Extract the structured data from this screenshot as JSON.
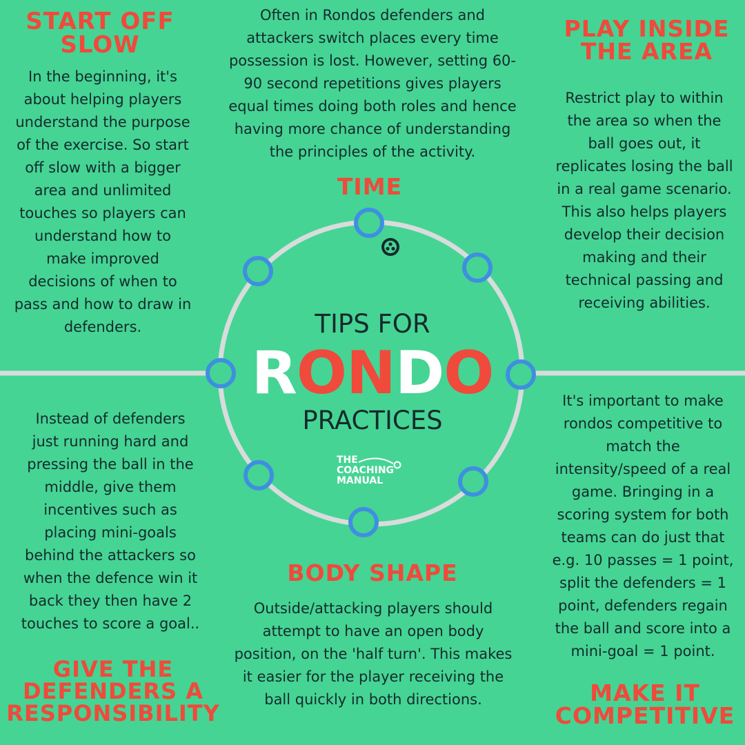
{
  "colors": {
    "background": "#45d494",
    "heading_red": "#ef4a3b",
    "body_text": "#152a2c",
    "pitch_line": "#d8dcdc",
    "player_ring": "#3f8fe0",
    "white": "#ffffff"
  },
  "center": {
    "tips_for": "TIPS FOR",
    "rondo_letters": [
      "R",
      "O",
      "N",
      "D",
      "O"
    ],
    "practices": "PRACTICES",
    "logo_lines": [
      "THE",
      "COACHING",
      "MANUAL"
    ],
    "ball_icon": "football-icon"
  },
  "sections": {
    "start_off_slow": {
      "heading": [
        "START OFF",
        "SLOW"
      ],
      "body": [
        "In the beginning, it's",
        "about helping players",
        "understand the purpose",
        "of the exercise. So start",
        "off slow with a bigger",
        "area and unlimited",
        "touches so players can",
        "understand how to",
        "make improved",
        "decisions of when to",
        "pass and how to draw in",
        "defenders."
      ]
    },
    "time": {
      "heading": [
        "TIME"
      ],
      "body": [
        "Often in Rondos defenders and",
        "attackers switch places every time",
        "possession is lost. However, setting 60-",
        "90 second repetitions gives players",
        "equal times doing both roles and hence",
        "having more chance of understanding",
        "the principles of the activity."
      ]
    },
    "play_inside": {
      "heading": [
        "PLAY INSIDE",
        "THE AREA"
      ],
      "body": [
        "Restrict play to within",
        "the area so when the",
        "ball goes out, it",
        "replicates losing the ball",
        "in a real game scenario.",
        "This also helps players",
        "develop their decision",
        "making and their",
        "technical passing and",
        "receiving abilities."
      ]
    },
    "defenders": {
      "heading": [
        "GIVE THE",
        "DEFENDERS A",
        "RESPONSIBILITY"
      ],
      "body": [
        "Instead of defenders",
        "just running hard and",
        "pressing the ball in the",
        "middle, give them",
        "incentives such as",
        "placing mini-goals",
        "behind the attackers so",
        "when the defence win it",
        "back they then have 2",
        "touches to score a goal.."
      ]
    },
    "body_shape": {
      "heading": [
        "BODY SHAPE"
      ],
      "body": [
        "Outside/attacking players should",
        "attempt to have an open body",
        "position, on the 'half turn'. This makes",
        "it easier for the player receiving the",
        "ball quickly in both directions."
      ]
    },
    "competitive": {
      "heading": [
        "MAKE IT",
        "COMPETITIVE"
      ],
      "body": [
        "It's important to make",
        "rondos competitive to",
        "match the",
        "intensity/speed of a real",
        "game. Bringing in a",
        "scoring system for both",
        "teams can do just that",
        "e.g. 10 passes = 1 point,",
        "split the defenders = 1",
        "point, defenders regain",
        "the ball and score into a",
        "mini-goal = 1 point."
      ]
    }
  }
}
